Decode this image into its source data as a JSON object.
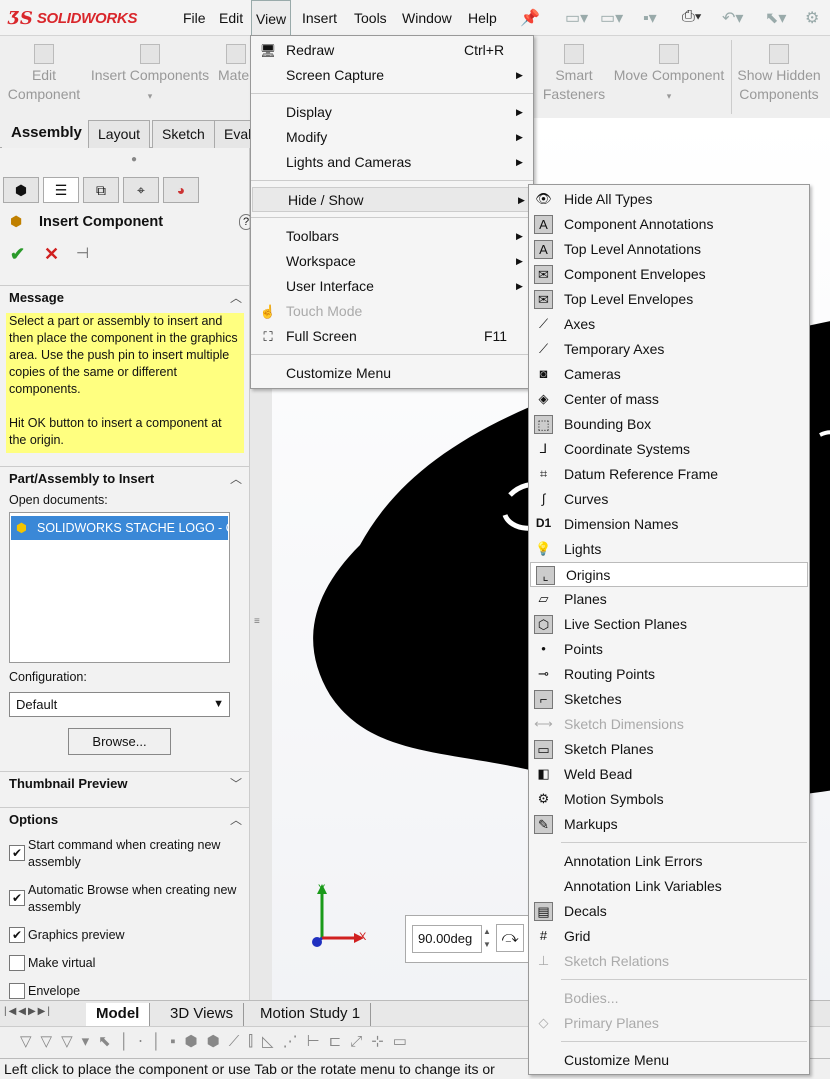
{
  "app": {
    "logo_text": "SOLIDWORKS",
    "brand_color": "#d9262b"
  },
  "menubar": [
    "File",
    "Edit",
    "View",
    "Insert",
    "Tools",
    "Window",
    "Help"
  ],
  "command_manager": {
    "buttons": [
      {
        "label": "Edit\nComponent",
        "icon": "edit-component-icon"
      },
      {
        "label": "Insert Components",
        "icon": "insert-components-icon"
      },
      {
        "label": "Mate",
        "icon": "mate-icon"
      },
      {
        "label": "Smart\nFasteners",
        "icon": "smart-fasteners-icon"
      },
      {
        "label": "Move Component",
        "icon": "move-component-icon"
      },
      {
        "label": "Show Hidden\nComponents",
        "icon": "show-hidden-components-icon"
      }
    ]
  },
  "tabs": [
    "Assembly",
    "Layout",
    "Sketch",
    "Eval"
  ],
  "property_manager": {
    "title": "Insert Component",
    "help": "?",
    "message_header": "Message",
    "message": "Select a part or assembly to insert and then place the component in the graphics area. Use the push pin to insert multiple copies of the same or different components.\n\nHit OK button to insert a component at the origin.",
    "part_header": "Part/Assembly to Insert",
    "open_documents_label": "Open documents:",
    "documents": [
      "SOLIDWORKS STACHE LOGO - C"
    ],
    "configuration_label": "Configuration:",
    "configuration_value": "Default",
    "browse_label": "Browse...",
    "thumbnail_header": "Thumbnail Preview",
    "options_header": "Options",
    "options": [
      {
        "label": "Start command when creating new assembly",
        "checked": true
      },
      {
        "label": "Automatic Browse when creating new assembly",
        "checked": true
      },
      {
        "label": "Graphics preview",
        "checked": true
      },
      {
        "label": "Make virtual",
        "checked": false
      },
      {
        "label": "Envelope",
        "checked": false
      }
    ]
  },
  "view_menu": [
    {
      "label": "Redraw",
      "shortcut": "Ctrl+R",
      "icon": "redraw-icon"
    },
    {
      "label": "Screen Capture",
      "submenu": true
    },
    {
      "sep": true
    },
    {
      "label": "Display",
      "submenu": true
    },
    {
      "label": "Modify",
      "submenu": true
    },
    {
      "label": "Lights and Cameras",
      "submenu": true
    },
    {
      "sep": true
    },
    {
      "label": "Hide / Show",
      "submenu": true,
      "highlight": true
    },
    {
      "sep": true
    },
    {
      "label": "Toolbars",
      "submenu": true
    },
    {
      "label": "Workspace",
      "submenu": true
    },
    {
      "label": "User Interface",
      "submenu": true
    },
    {
      "label": "Touch Mode",
      "disabled": true,
      "icon": "touch-mode-icon"
    },
    {
      "label": "Full Screen",
      "shortcut": "F11",
      "icon": "full-screen-icon"
    },
    {
      "sep": true
    },
    {
      "label": "Customize Menu"
    }
  ],
  "hide_show_menu": [
    {
      "label": "Hide All Types",
      "icon": "eye-icon"
    },
    {
      "label": "Component Annotations",
      "icon": "component-annotations-icon"
    },
    {
      "label": "Top Level Annotations",
      "icon": "top-level-annotations-icon"
    },
    {
      "label": "Component Envelopes",
      "icon": "component-envelopes-icon"
    },
    {
      "label": "Top Level Envelopes",
      "icon": "top-level-envelopes-icon"
    },
    {
      "label": "Axes",
      "icon": "axes-icon"
    },
    {
      "label": "Temporary Axes",
      "icon": "temporary-axes-icon"
    },
    {
      "label": "Cameras",
      "icon": "camera-icon"
    },
    {
      "label": "Center of mass",
      "icon": "center-of-mass-icon"
    },
    {
      "label": "Bounding Box",
      "icon": "bounding-box-icon"
    },
    {
      "label": "Coordinate Systems",
      "icon": "coordinate-systems-icon"
    },
    {
      "label": "Datum Reference Frame",
      "icon": "datum-reference-frame-icon"
    },
    {
      "label": "Curves",
      "icon": "curves-icon"
    },
    {
      "label": "Dimension Names",
      "icon": "dimension-names-icon"
    },
    {
      "label": "Lights",
      "icon": "light-bulb-icon"
    },
    {
      "label": "Origins",
      "icon": "origins-icon",
      "highlight": true
    },
    {
      "label": "Planes",
      "icon": "planes-icon"
    },
    {
      "label": "Live Section Planes",
      "icon": "live-section-planes-icon"
    },
    {
      "label": "Points",
      "icon": "points-icon"
    },
    {
      "label": "Routing Points",
      "icon": "routing-points-icon"
    },
    {
      "label": "Sketches",
      "icon": "sketches-icon"
    },
    {
      "label": "Sketch Dimensions",
      "icon": "sketch-dimensions-icon",
      "disabled": true
    },
    {
      "label": "Sketch Planes",
      "icon": "sketch-planes-icon"
    },
    {
      "label": "Weld Bead",
      "icon": "weld-bead-icon"
    },
    {
      "label": "Motion Symbols",
      "icon": "motion-symbols-icon"
    },
    {
      "label": "Markups",
      "icon": "markups-icon"
    },
    {
      "sep": true
    },
    {
      "label": "Annotation Link Errors"
    },
    {
      "label": "Annotation Link Variables"
    },
    {
      "label": "Decals",
      "icon": "decals-icon"
    },
    {
      "label": "Grid",
      "icon": "grid-icon"
    },
    {
      "label": "Sketch Relations",
      "icon": "sketch-relations-icon",
      "disabled": true
    },
    {
      "sep": true
    },
    {
      "label": "Bodies...",
      "disabled": true
    },
    {
      "label": "Primary Planes",
      "icon": "primary-planes-icon",
      "disabled": true
    },
    {
      "sep": true
    },
    {
      "label": "Customize Menu"
    }
  ],
  "rotate_box": {
    "value": "90.00deg"
  },
  "triad": {
    "x": "X",
    "y": "Y"
  },
  "bottom_tabs": [
    "Model",
    "3D Views",
    "Motion Study 1"
  ],
  "status_text": "Left click to place the component or use Tab or the rotate menu to change its or"
}
